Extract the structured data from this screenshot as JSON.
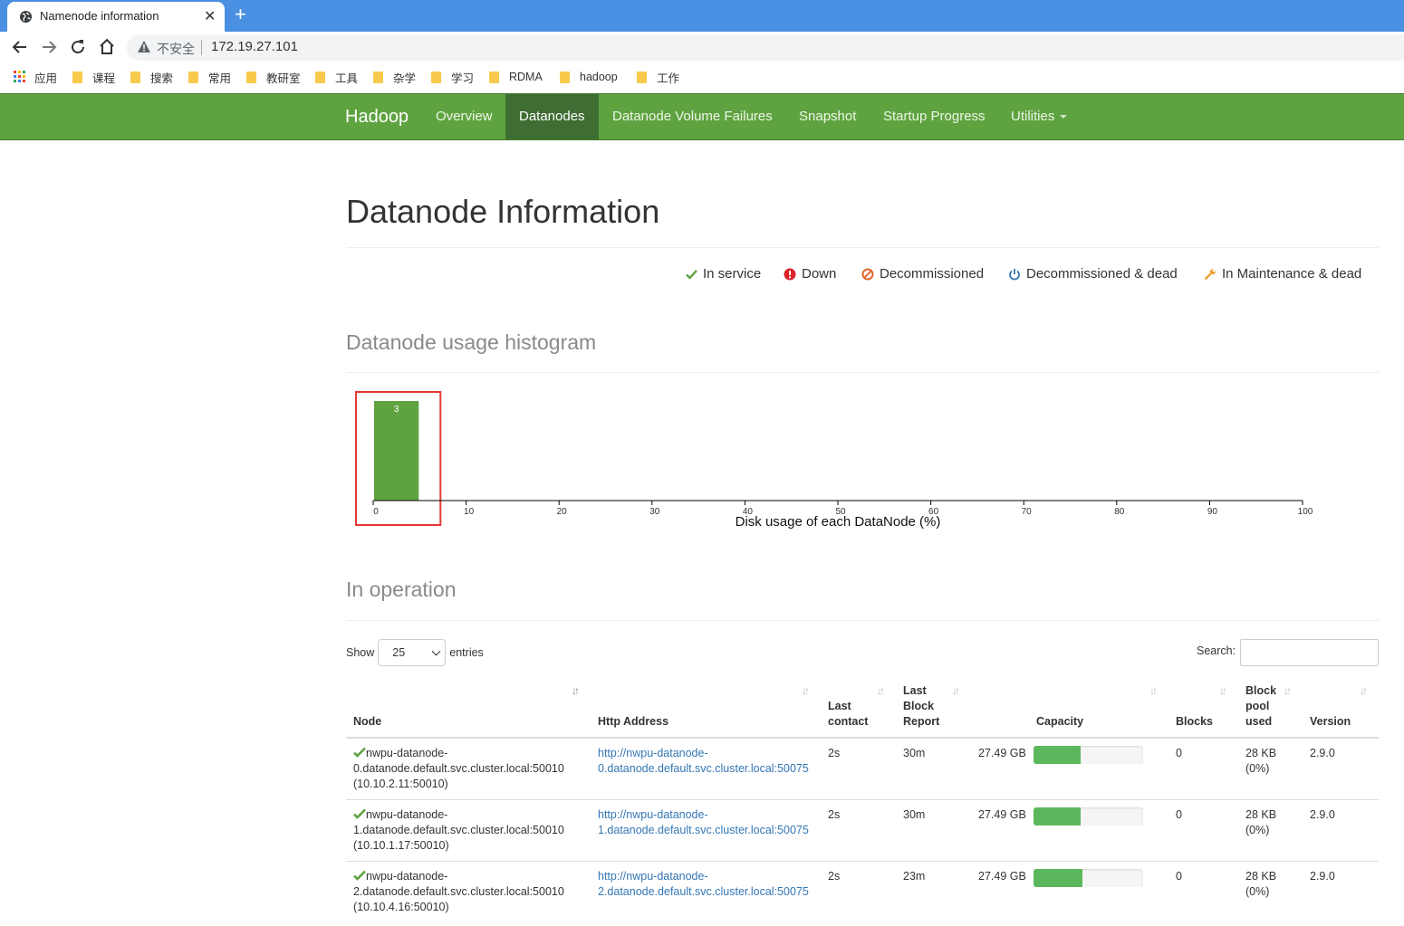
{
  "browser": {
    "tab_title": "Namenode information",
    "new_tab_symbol": "+",
    "close_symbol": "✕",
    "insecure_label": "不安全",
    "url": "172.19.27.101"
  },
  "bookmarks": [
    "应用",
    "课程",
    "搜索",
    "常用",
    "教研室",
    "工具",
    "杂学",
    "学习",
    "RDMA",
    "hadoop",
    "工作"
  ],
  "navbar": {
    "brand": "Hadoop",
    "items": [
      "Overview",
      "Datanodes",
      "Datanode Volume Failures",
      "Snapshot",
      "Startup Progress",
      "Utilities"
    ],
    "active": "Datanodes"
  },
  "page_title": "Datanode Information",
  "legend": {
    "in_service": "In service",
    "down": "Down",
    "decommissioned": "Decommissioned",
    "decommissioned_dead": "Decommissioned & dead",
    "maintenance_dead": "In Maintenance & dead"
  },
  "colors": {
    "navbar": "#5fa341",
    "bar": "#5fa341",
    "progress": "#5cb85c",
    "link": "#3477b5",
    "highlight": "#e53935"
  },
  "histogram_title": "Datanode usage histogram",
  "chart_data": {
    "type": "bar",
    "xlabel": "Disk usage of each DataNode (%)",
    "xlim": [
      0,
      100
    ],
    "x_ticks": [
      0,
      10,
      20,
      30,
      40,
      50,
      60,
      70,
      80,
      90,
      100
    ],
    "bins": [
      {
        "range": [
          0,
          5
        ],
        "count": 3
      }
    ],
    "highlighted_bin": 0
  },
  "in_operation_title": "In operation",
  "table_controls": {
    "show_label": "Show",
    "entries_value": "25",
    "entries_label": "entries",
    "search_label": "Search:"
  },
  "table": {
    "headers": {
      "node": "Node",
      "http": "Http Address",
      "last_contact": [
        "Last",
        "contact"
      ],
      "last_block_report": [
        "Last",
        "Block",
        "Report"
      ],
      "capacity": "Capacity",
      "blocks": "Blocks",
      "block_pool_used": [
        "Block",
        "pool",
        "used"
      ],
      "version": "Version"
    },
    "rows": [
      {
        "node": [
          "nwpu-datanode-",
          "0.datanode.default.svc.cluster.local:50010",
          "(10.10.2.11:50010)"
        ],
        "http": [
          "http://nwpu-datanode-",
          "0.datanode.default.svc.cluster.local:50075"
        ],
        "last_contact": "2s",
        "last_block_report": "30m",
        "capacity": "27.49 GB",
        "used_fraction": 0.43,
        "blocks": "0",
        "block_pool_used": [
          "28 KB",
          "(0%)"
        ],
        "version": "2.9.0"
      },
      {
        "node": [
          "nwpu-datanode-",
          "1.datanode.default.svc.cluster.local:50010",
          "(10.10.1.17:50010)"
        ],
        "http": [
          "http://nwpu-datanode-",
          "1.datanode.default.svc.cluster.local:50075"
        ],
        "last_contact": "2s",
        "last_block_report": "30m",
        "capacity": "27.49 GB",
        "used_fraction": 0.43,
        "blocks": "0",
        "block_pool_used": [
          "28 KB",
          "(0%)"
        ],
        "version": "2.9.0"
      },
      {
        "node": [
          "nwpu-datanode-",
          "2.datanode.default.svc.cluster.local:50010",
          "(10.10.4.16:50010)"
        ],
        "http": [
          "http://nwpu-datanode-",
          "2.datanode.default.svc.cluster.local:50075"
        ],
        "last_contact": "2s",
        "last_block_report": "23m",
        "capacity": "27.49 GB",
        "used_fraction": 0.45,
        "blocks": "0",
        "block_pool_used": [
          "28 KB",
          "(0%)"
        ],
        "version": "2.9.0"
      }
    ]
  }
}
